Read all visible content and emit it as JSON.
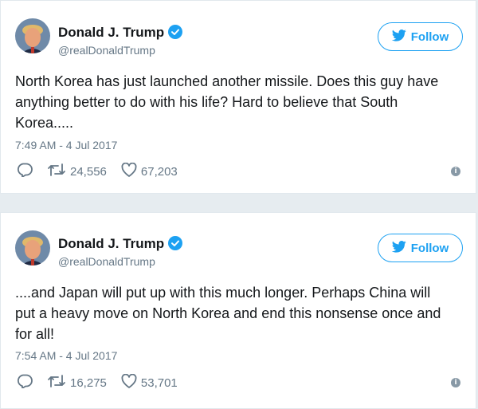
{
  "tweets": [
    {
      "author_name": "Donald J. Trump",
      "handle": "@realDonaldTrump",
      "follow_label": "Follow",
      "text_lines": [
        "North Korea has just launched another missile. Does this guy have",
        "anything better to do with his life? Hard to believe that South",
        "Korea....."
      ],
      "timestamp": "7:49 AM - 4 Jul 2017",
      "retweets": "24,556",
      "likes": "67,203"
    },
    {
      "author_name": "Donald J. Trump",
      "handle": "@realDonaldTrump",
      "follow_label": "Follow",
      "text_lines": [
        "....and Japan will put up with this much longer. Perhaps China will",
        "put a heavy move on North Korea and end this nonsense once and",
        "for all!"
      ],
      "timestamp": "7:54 AM - 4 Jul 2017",
      "retweets": "16,275",
      "likes": "53,701"
    }
  ],
  "colors": {
    "accent": "#1da1f2",
    "text": "#14171a",
    "secondary": "#657786",
    "background": "#e6ecf0"
  },
  "icons": [
    "verified-badge-icon",
    "twitter-bird-icon",
    "reply-icon",
    "retweet-icon",
    "like-heart-icon",
    "info-icon",
    "avatar"
  ]
}
